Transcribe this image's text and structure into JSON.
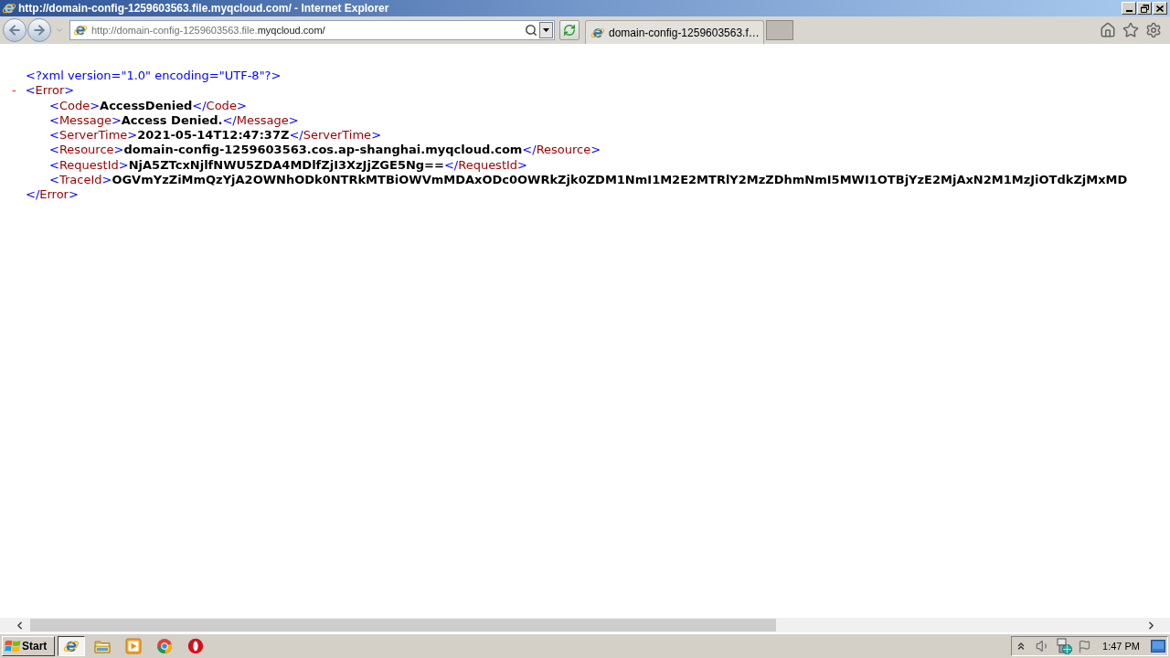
{
  "window": {
    "title": "http://domain-config-1259603563.file.myqcloud.com/ - Internet Explorer"
  },
  "address_bar": {
    "url_start": "http://domain-config-1259603563.file.",
    "url_domain": "myqcloud.com/"
  },
  "tabs": [
    {
      "label": "domain-config-1259603563.f…",
      "selected": true
    }
  ],
  "document": {
    "declaration": [
      {
        "kind": "markup",
        "text": "<?xml version=\"1.0\" encoding=\"UTF-8\"?>"
      }
    ],
    "root": {
      "toggle": "-",
      "expanded": true,
      "open": [
        {
          "kind": "markup",
          "text": "<"
        },
        {
          "kind": "tag",
          "text": "Error"
        },
        {
          "kind": "markup",
          "text": ">"
        }
      ],
      "children": [
        {
          "tokens": [
            {
              "kind": "markup",
              "text": "<"
            },
            {
              "kind": "tag",
              "text": "Code"
            },
            {
              "kind": "markup",
              "text": ">"
            },
            {
              "kind": "content",
              "text": "AccessDenied"
            },
            {
              "kind": "markup",
              "text": "</"
            },
            {
              "kind": "tag",
              "text": "Code"
            },
            {
              "kind": "markup",
              "text": ">"
            }
          ]
        },
        {
          "tokens": [
            {
              "kind": "markup",
              "text": "<"
            },
            {
              "kind": "tag",
              "text": "Message"
            },
            {
              "kind": "markup",
              "text": ">"
            },
            {
              "kind": "content",
              "text": "Access Denied."
            },
            {
              "kind": "markup",
              "text": "</"
            },
            {
              "kind": "tag",
              "text": "Message"
            },
            {
              "kind": "markup",
              "text": ">"
            }
          ]
        },
        {
          "tokens": [
            {
              "kind": "markup",
              "text": "<"
            },
            {
              "kind": "tag",
              "text": "ServerTime"
            },
            {
              "kind": "markup",
              "text": ">"
            },
            {
              "kind": "content",
              "text": "2021-05-14T12:47:37Z"
            },
            {
              "kind": "markup",
              "text": "</"
            },
            {
              "kind": "tag",
              "text": "ServerTime"
            },
            {
              "kind": "markup",
              "text": ">"
            }
          ]
        },
        {
          "tokens": [
            {
              "kind": "markup",
              "text": "<"
            },
            {
              "kind": "tag",
              "text": "Resource"
            },
            {
              "kind": "markup",
              "text": ">"
            },
            {
              "kind": "content",
              "text": "domain-config-1259603563.cos.ap-shanghai.myqcloud.com"
            },
            {
              "kind": "markup",
              "text": "</"
            },
            {
              "kind": "tag",
              "text": "Resource"
            },
            {
              "kind": "markup",
              "text": ">"
            }
          ]
        },
        {
          "tokens": [
            {
              "kind": "markup",
              "text": "<"
            },
            {
              "kind": "tag",
              "text": "RequestId"
            },
            {
              "kind": "markup",
              "text": ">"
            },
            {
              "kind": "content",
              "text": "NjA5ZTcxNjlfNWU5ZDA4MDlfZjI3XzJjZGE5Ng=="
            },
            {
              "kind": "markup",
              "text": "</"
            },
            {
              "kind": "tag",
              "text": "RequestId"
            },
            {
              "kind": "markup",
              "text": ">"
            }
          ]
        },
        {
          "tokens": [
            {
              "kind": "markup",
              "text": "<"
            },
            {
              "kind": "tag",
              "text": "TraceId"
            },
            {
              "kind": "markup",
              "text": ">"
            },
            {
              "kind": "content",
              "text": "OGVmYzZiMmQzYjA2OWNhODk0NTRkMTBiOWVmMDAxODc0OWRkZjk0ZDM1NmI1M2E2MTRlY2MzZDhmNmI5MWI1OTBjYzE2MjAxN2M1MzJiOTdkZjMxMD"
            }
          ]
        }
      ],
      "close": [
        {
          "kind": "markup",
          "text": "</"
        },
        {
          "kind": "tag",
          "text": "Error"
        },
        {
          "kind": "markup",
          "text": ">"
        }
      ]
    }
  },
  "taskbar": {
    "start": "Start",
    "buttons": [
      {
        "kind": "e_logo",
        "selected": true
      },
      {
        "kind": "folder",
        "selected": false
      },
      {
        "kind": "player",
        "selected": false
      },
      {
        "kind": "ring",
        "selected": false
      },
      {
        "kind": "o_logo",
        "selected": false
      }
    ],
    "clock": "1:47 PM"
  }
}
